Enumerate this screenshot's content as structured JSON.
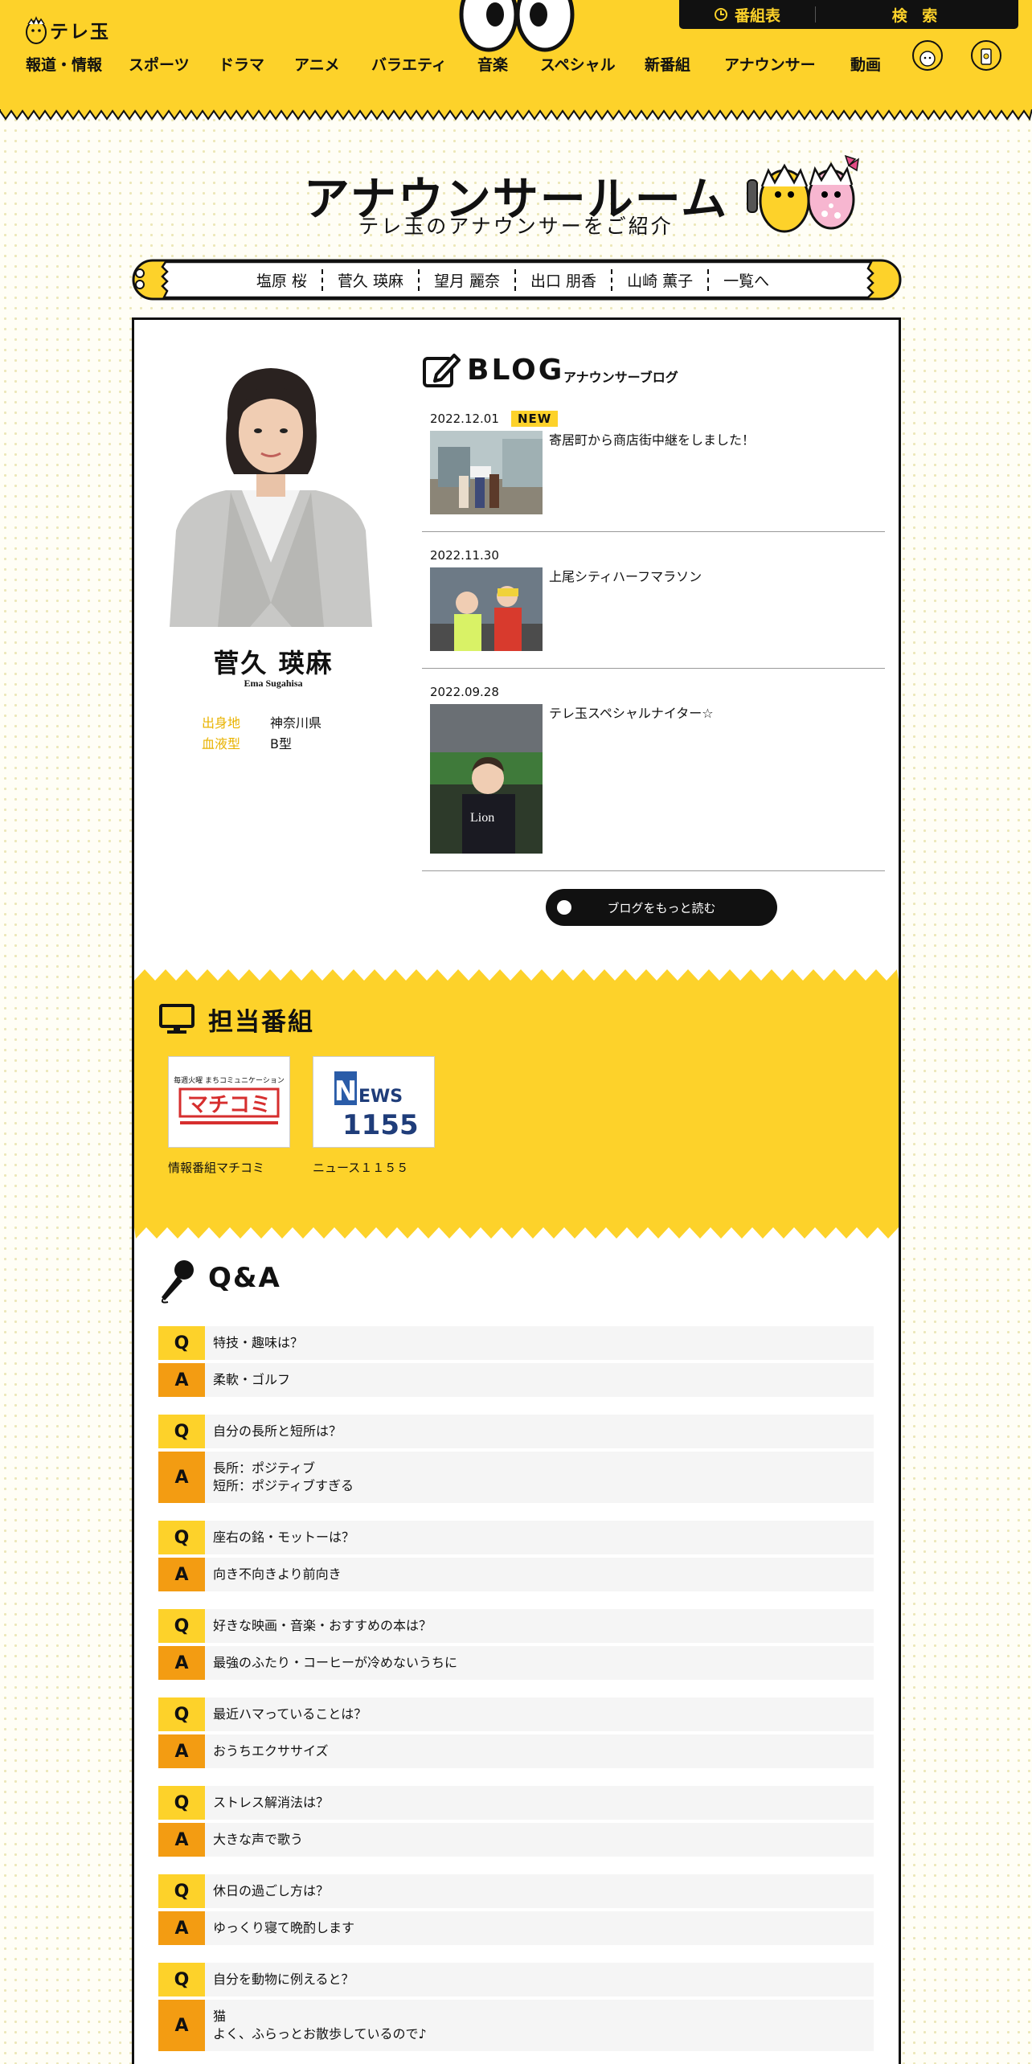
{
  "header": {
    "logo_text": "テレ玉",
    "schedule_label": "番組表",
    "search_label": "検 索",
    "nav": [
      "報道・情報",
      "スポーツ",
      "ドラマ",
      "アニメ",
      "バラエティ",
      "音楽",
      "スペシャル",
      "新番組",
      "アナウンサー",
      "動画"
    ],
    "badge1_label": "テレ玉",
    "badge2_label": "テレ玉アプリ"
  },
  "page": {
    "title": "アナウンサールーム",
    "subtitle": "テレ玉のアナウンサーをご紹介"
  },
  "announcer_nav": [
    "塩原 桜",
    "菅久 瑛麻",
    "望月 麗奈",
    "出口 朋香",
    "山崎 薫子",
    "一覧へ"
  ],
  "profile": {
    "name": "菅久 瑛麻",
    "name_roman": "Ema Sugahisa",
    "fields": [
      {
        "key": "出身地",
        "value": "神奈川県"
      },
      {
        "key": "血液型",
        "value": "B型"
      }
    ]
  },
  "blog": {
    "heading": "BLOG",
    "subheading": "アナウンサーブログ",
    "new_badge": "NEW",
    "entries": [
      {
        "date": "2022.12.01",
        "title": "寄居町から商店街中継をしました！"
      },
      {
        "date": "2022.11.30",
        "title": "上尾シティハーフマラソン"
      },
      {
        "date": "2022.09.28",
        "title": "テレ玉スペシャルナイター☆"
      }
    ],
    "more_label": "ブログをもっと読む"
  },
  "programs": {
    "heading": "担当番組",
    "items": [
      {
        "caption": "情報番組マチコミ",
        "logo_text": "マチコミ",
        "logo_sub": "毎週火曜 まちコミュニケーション"
      },
      {
        "caption": "ニュース１１５５",
        "logo_text": "EWS",
        "logo_num": "1155",
        "logo_n": "N"
      }
    ]
  },
  "qa": {
    "heading": "Q&A",
    "q_mark": "Q",
    "a_mark": "A",
    "items": [
      {
        "q": "特技・趣味は？",
        "a": "柔軟・ゴルフ"
      },
      {
        "q": "自分の長所と短所は？",
        "a": "長所：ポジティブ\n短所：ポジティブすぎる"
      },
      {
        "q": "座右の銘・モットーは？",
        "a": "向き不向きより前向き"
      },
      {
        "q": "好きな映画・音楽・おすすめの本は？",
        "a": "最強のふたり・コーヒーが冷めないうちに"
      },
      {
        "q": "最近ハマっていることは？",
        "a": "おうちエクササイズ"
      },
      {
        "q": "ストレス解消法は？",
        "a": "大きな声で歌う"
      },
      {
        "q": "休日の過ごし方は？",
        "a": "ゆっくり寝て晩酌します"
      },
      {
        "q": "自分を動物に例えると？",
        "a": "猫\nよく、ふらっとお散歩しているので♪"
      }
    ]
  },
  "colors": {
    "accent": "#fdd22a",
    "answer": "#f39c12",
    "dark": "#111111"
  }
}
